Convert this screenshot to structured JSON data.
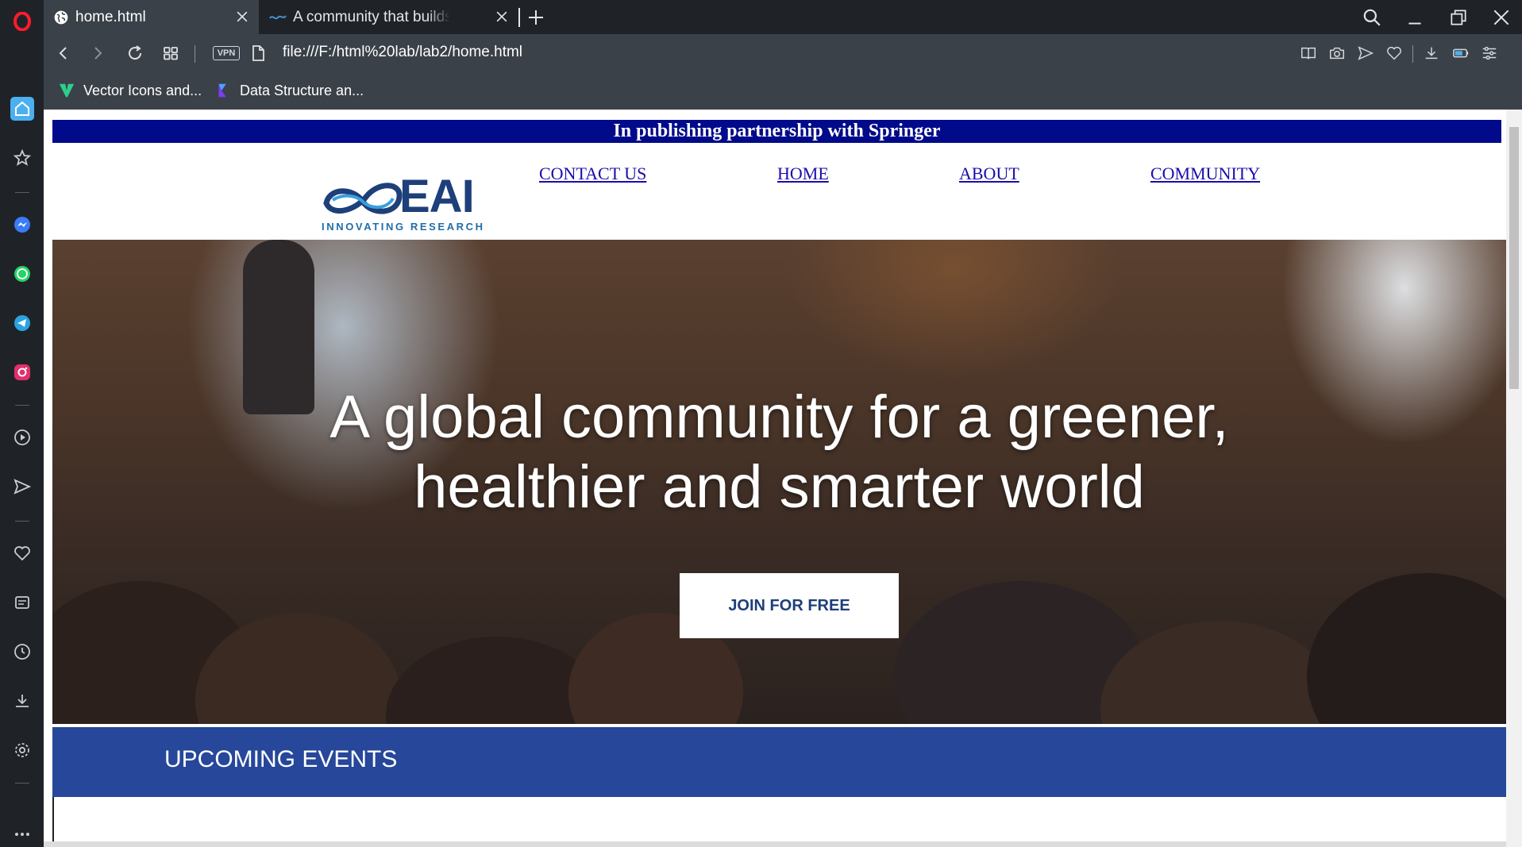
{
  "browser": {
    "tabs": [
      {
        "label": "home.html",
        "active": true,
        "icon": "globe-icon"
      },
      {
        "label": "A community that builds",
        "active": false,
        "icon": "eai-logo-icon"
      }
    ],
    "url": "file:///F:/html%20lab/lab2/home.html",
    "vpn_label": "VPN",
    "bookmarks": [
      {
        "label": "Vector Icons and...",
        "icon": "vector-icons-logo"
      },
      {
        "label": "Data Structure an...",
        "icon": "data-structure-logo"
      }
    ],
    "sidebar_icons": [
      "opera-logo",
      "home-icon",
      "star-icon",
      "messenger-icon",
      "whatsapp-icon",
      "telegram-icon",
      "instagram-icon",
      "player-icon",
      "send-icon",
      "heart-icon",
      "news-icon",
      "history-icon",
      "download-icon",
      "settings-icon",
      "more-icon"
    ]
  },
  "page": {
    "banner": "In publishing partnership with Springer",
    "logo": {
      "name": "EAI",
      "tagline": "INNOVATING RESEARCH"
    },
    "nav": [
      {
        "label": "CONTACT US"
      },
      {
        "label": "HOME"
      },
      {
        "label": "ABOUT"
      },
      {
        "label": "COMMUNITY"
      }
    ],
    "hero": {
      "heading_line1": "A global community for a greener,",
      "heading_line2": "healthier and smarter world",
      "cta": "JOIN FOR FREE"
    },
    "section_title": "UPCOMING EVENTS"
  },
  "colors": {
    "banner_bg": "#000a8a",
    "brand_blue": "#1d3f7a",
    "events_band": "#26479a",
    "link": "#1a0dab"
  }
}
